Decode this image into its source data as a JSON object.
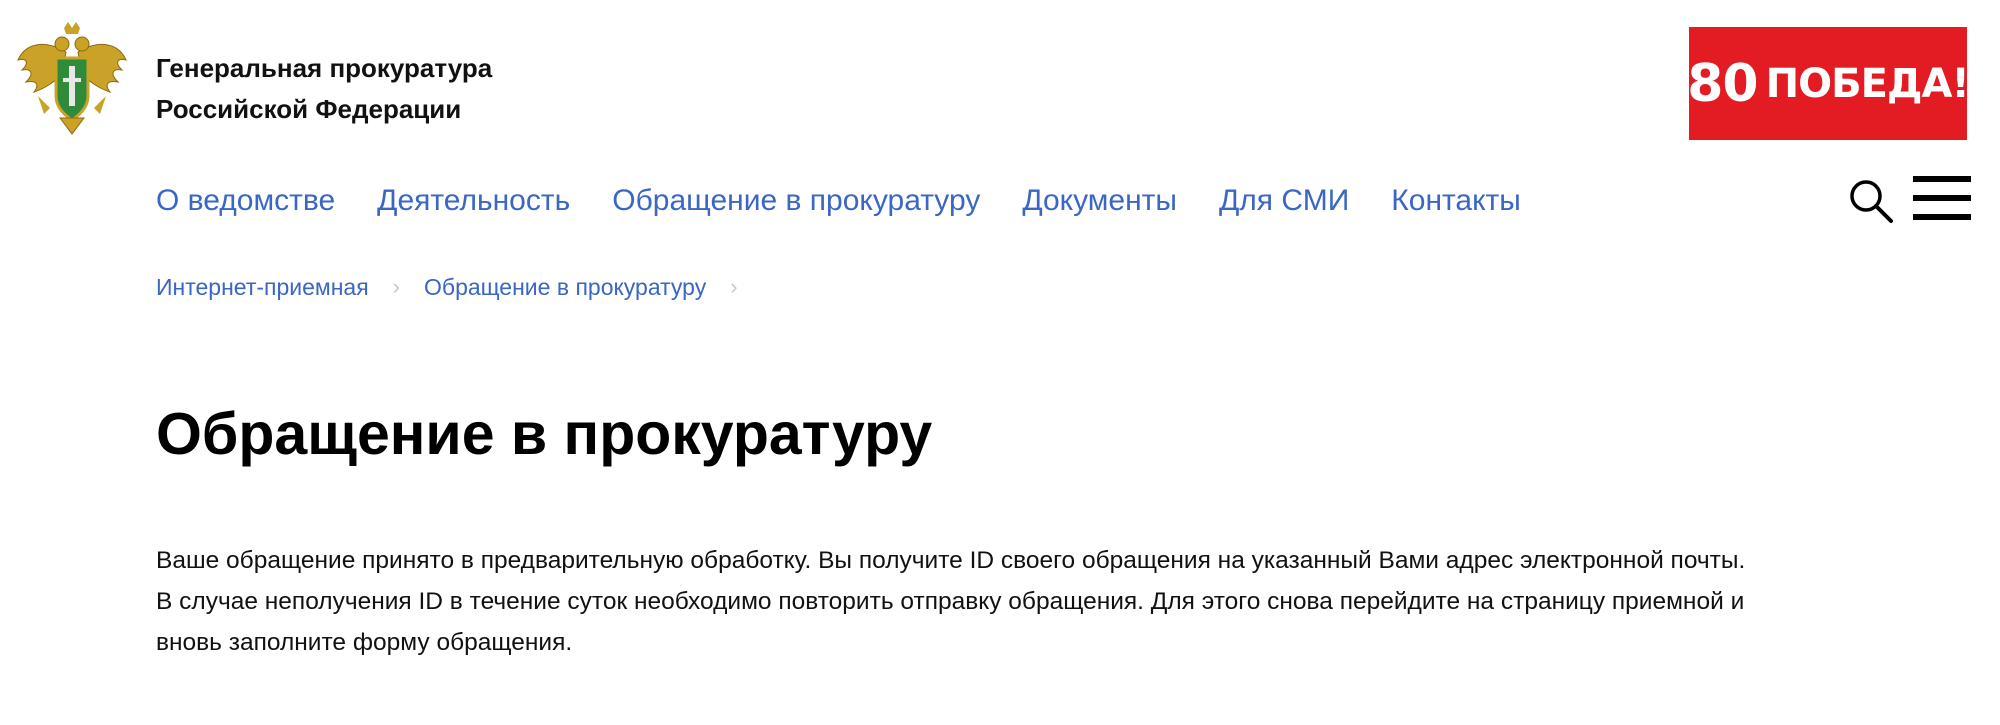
{
  "header": {
    "org_line1": "Генеральная прокуратура",
    "org_line2": "Российской Федерации",
    "victory_number": "80",
    "victory_word": "ПОБЕДА!",
    "victory_color": "#e31b23"
  },
  "nav": {
    "items": [
      {
        "label": "О ведомстве"
      },
      {
        "label": "Деятельность"
      },
      {
        "label": "Обращение в прокуратуру"
      },
      {
        "label": "Документы"
      },
      {
        "label": "Для СМИ"
      },
      {
        "label": "Контакты"
      }
    ],
    "link_color": "#3a66c4",
    "search_icon": "search-icon",
    "menu_icon": "hamburger-menu-icon"
  },
  "breadcrumb": {
    "items": [
      {
        "label": "Интернет-приемная"
      },
      {
        "label": "Обращение в прокуратуру"
      }
    ],
    "separator": "›"
  },
  "main": {
    "title": "Обращение в прокуратуру",
    "notice_line1": "Ваше обращение принято в предварительную обработку. Вы получите ID своего обращения на указанный Вами адрес электронной почты.",
    "notice_line2": "В случае неполучения ID в течение суток необходимо повторить отправку обращения. Для этого снова перейдите на страницу приемной и",
    "notice_line3": "вновь заполните форму обращения."
  }
}
